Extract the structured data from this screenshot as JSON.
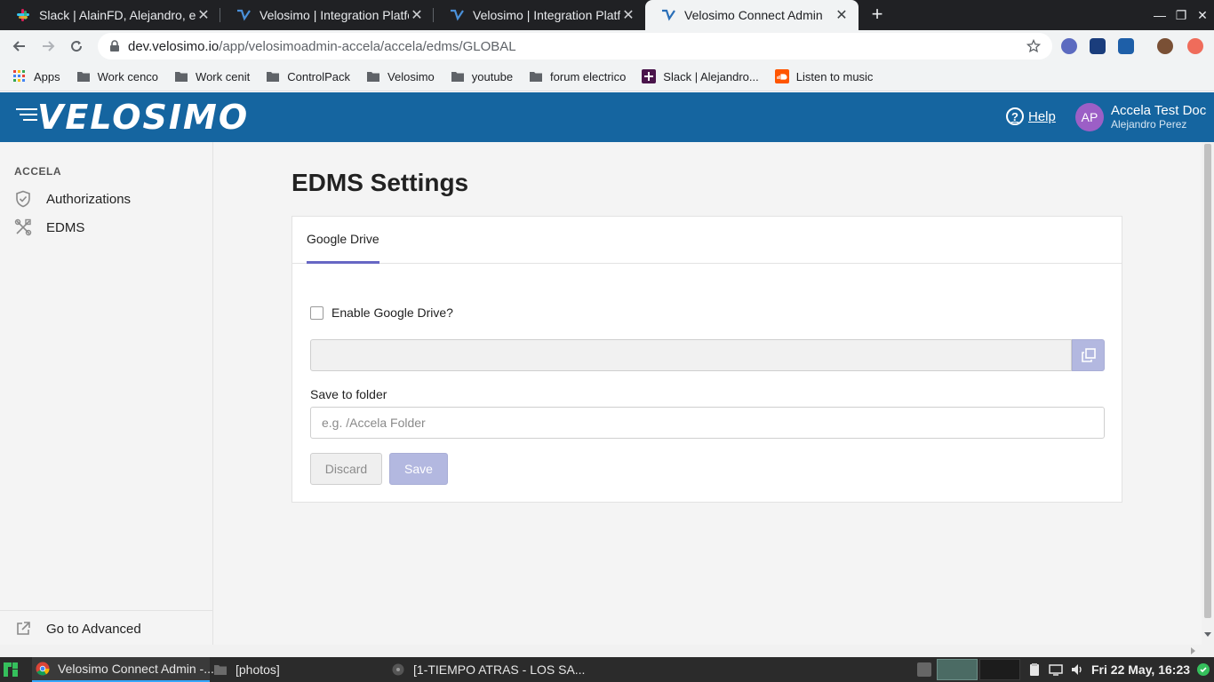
{
  "browser": {
    "tabs": [
      {
        "title": "Slack | AlainFD, Alejandro, elv",
        "icon": "slack-icon",
        "active": false
      },
      {
        "title": "Velosimo | Integration Platfo",
        "icon": "velosimo-icon",
        "active": false
      },
      {
        "title": "Velosimo | Integration Platfo",
        "icon": "velosimo-icon",
        "active": false
      },
      {
        "title": "Velosimo Connect Admin",
        "icon": "velosimo-icon",
        "active": true
      }
    ],
    "url_host": "dev.velosimo.io",
    "url_path": "/app/velosimoadmin-accela/accela/edms/GLOBAL",
    "bookmarks": [
      {
        "label": "Apps",
        "icon": "apps-grid-icon"
      },
      {
        "label": "Work cenco",
        "icon": "folder-icon"
      },
      {
        "label": "Work cenit",
        "icon": "folder-icon"
      },
      {
        "label": "ControlPack",
        "icon": "folder-icon"
      },
      {
        "label": "Velosimo",
        "icon": "folder-icon"
      },
      {
        "label": "youtube",
        "icon": "folder-icon"
      },
      {
        "label": "forum electrico",
        "icon": "folder-icon"
      },
      {
        "label": "Slack | Alejandro...",
        "icon": "slack-icon"
      },
      {
        "label": "Listen to music",
        "icon": "soundcloud-icon"
      }
    ]
  },
  "header": {
    "brand": "VELOSIMO",
    "help_label": "Help",
    "avatar_initials": "AP",
    "user_name": "Accela Test Doc",
    "user_sub": "Alejandro Perez",
    "colors": {
      "brand_bar": "#1565a0",
      "avatar": "#9c5fc6"
    }
  },
  "sidebar": {
    "section": "ACCELA",
    "items": [
      {
        "label": "Authorizations",
        "icon": "shield-check-icon"
      },
      {
        "label": "EDMS",
        "icon": "tools-icon"
      }
    ],
    "footer_label": "Go to Advanced",
    "footer_icon": "external-link-icon"
  },
  "main": {
    "title": "EDMS Settings",
    "tab_label": "Google Drive",
    "enable_label": "Enable Google Drive?",
    "enable_checked": false,
    "url_value": "",
    "folder_label": "Save to folder",
    "folder_placeholder": "e.g. /Accela Folder",
    "folder_value": "",
    "discard_label": "Discard",
    "save_label": "Save",
    "accent_color": "#6767c4"
  },
  "taskbar": {
    "items": [
      {
        "label": "Velosimo Connect Admin -...",
        "icon": "chrome-icon",
        "active": true
      },
      {
        "label": "[photos]",
        "icon": "folder-icon",
        "active": false
      },
      {
        "label": "[1-TIEMPO ATRAS - LOS SA...",
        "icon": "audio-player-icon",
        "active": false
      }
    ],
    "clock": "Fri 22 May, 16:23"
  }
}
